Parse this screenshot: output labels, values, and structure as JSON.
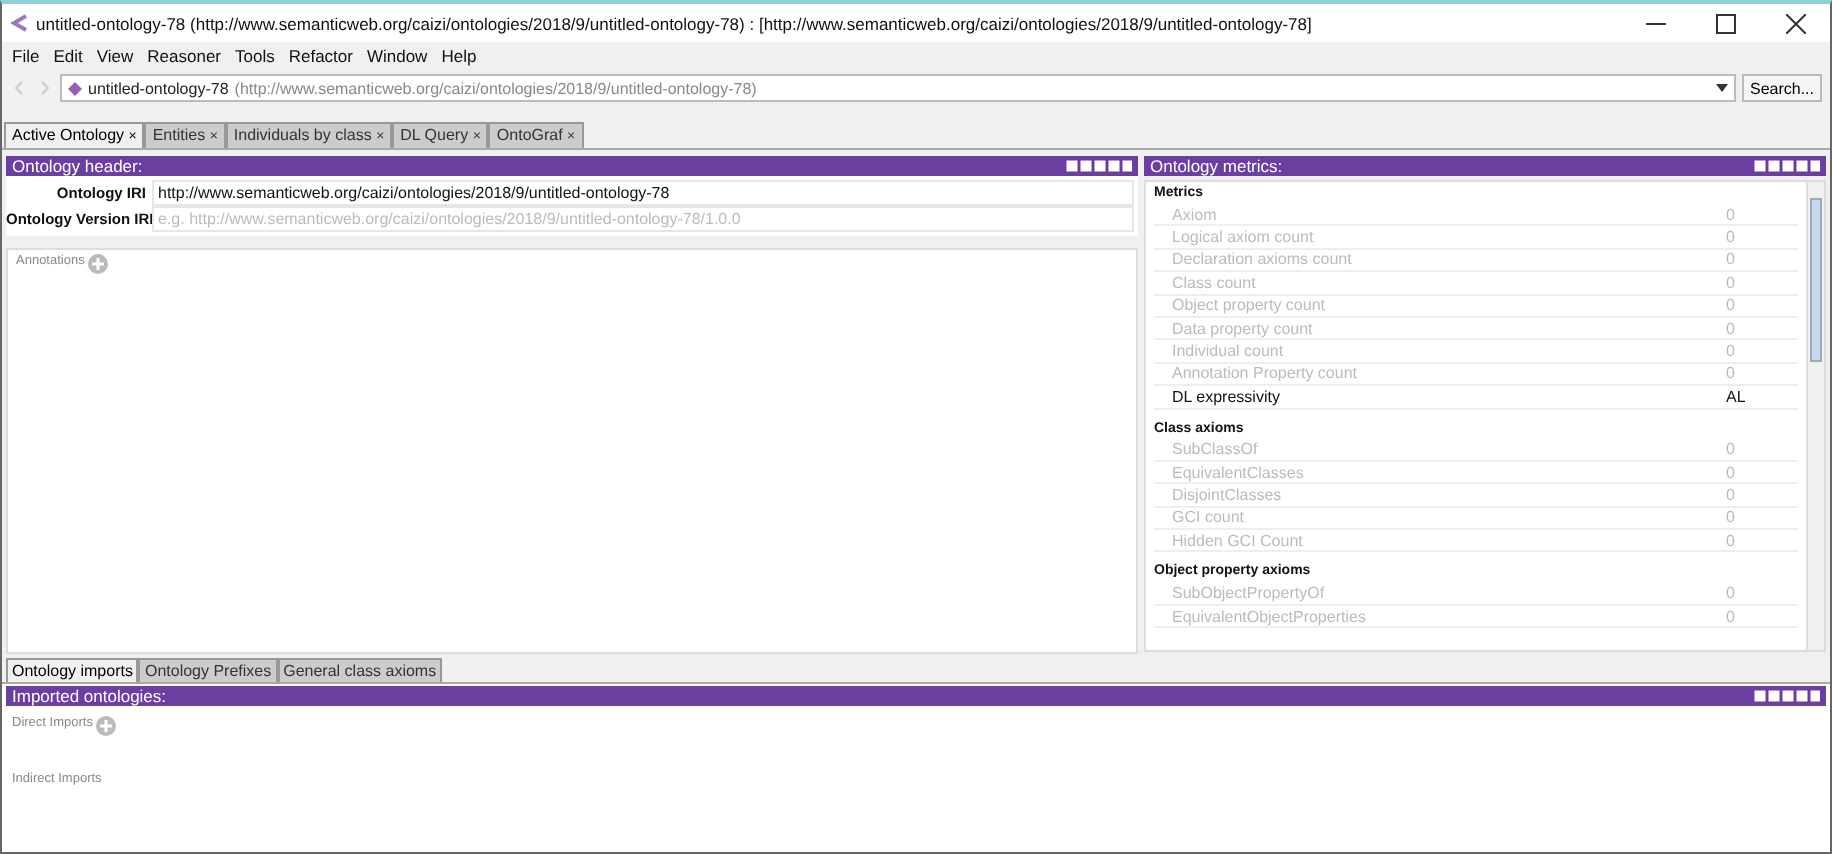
{
  "window": {
    "title": "untitled-ontology-78 (http://www.semanticweb.org/caizi/ontologies/2018/9/untitled-ontology-78)  : [http://www.semanticweb.org/caizi/ontologies/2018/9/untitled-ontology-78]"
  },
  "menu": [
    "File",
    "Edit",
    "View",
    "Reasoner",
    "Tools",
    "Refactor",
    "Window",
    "Help"
  ],
  "nav": {
    "ontology_name": "untitled-ontology-78",
    "ontology_iri": "(http://www.semanticweb.org/caizi/ontologies/2018/9/untitled-ontology-78)",
    "search_button": "Search..."
  },
  "tabs": [
    {
      "label": "Active Ontology",
      "selected": true,
      "close": "×"
    },
    {
      "label": "Entities",
      "selected": false,
      "close": "×"
    },
    {
      "label": "Individuals by class",
      "selected": false,
      "close": "×"
    },
    {
      "label": "DL Query",
      "selected": false,
      "close": "×"
    },
    {
      "label": "OntoGraf",
      "selected": false,
      "close": "×"
    }
  ],
  "header_panel": {
    "title": "Ontology header:",
    "fields": [
      {
        "label": "Ontology IRI",
        "value": "http://www.semanticweb.org/caizi/ontologies/2018/9/untitled-ontology-78"
      },
      {
        "label": "Ontology Version IRI",
        "placeholder": "e.g. http://www.semanticweb.org/caizi/ontologies/2018/9/untitled-ontology-78/1.0.0"
      }
    ],
    "annotations_label": "Annotations"
  },
  "metrics_panel": {
    "title": "Ontology metrics:",
    "rows": [
      {
        "kind": "section",
        "label": "Metrics"
      },
      {
        "kind": "metric",
        "label": "Axiom",
        "value": "0",
        "disabled": true
      },
      {
        "kind": "metric",
        "label": "Logical axiom count",
        "value": "0",
        "disabled": true
      },
      {
        "kind": "metric",
        "label": "Declaration axioms count",
        "value": "0",
        "disabled": true
      },
      {
        "kind": "metric",
        "label": "Class count",
        "value": "0",
        "disabled": true
      },
      {
        "kind": "metric",
        "label": "Object property count",
        "value": "0",
        "disabled": true
      },
      {
        "kind": "metric",
        "label": "Data property count",
        "value": "0",
        "disabled": true
      },
      {
        "kind": "metric",
        "label": "Individual count",
        "value": "0",
        "disabled": true
      },
      {
        "kind": "metric",
        "label": "Annotation Property count",
        "value": "0",
        "disabled": true
      },
      {
        "kind": "metric",
        "label": "DL expressivity",
        "value": "AL",
        "disabled": false
      },
      {
        "kind": "section",
        "label": "Class axioms"
      },
      {
        "kind": "metric",
        "label": "SubClassOf",
        "value": "0",
        "disabled": true
      },
      {
        "kind": "metric",
        "label": "EquivalentClasses",
        "value": "0",
        "disabled": true
      },
      {
        "kind": "metric",
        "label": "DisjointClasses",
        "value": "0",
        "disabled": true
      },
      {
        "kind": "metric",
        "label": "GCI count",
        "value": "0",
        "disabled": true
      },
      {
        "kind": "metric",
        "label": "Hidden GCI Count",
        "value": "0",
        "disabled": true
      },
      {
        "kind": "section",
        "label": "Object property axioms"
      },
      {
        "kind": "metric",
        "label": "SubObjectPropertyOf",
        "value": "0",
        "disabled": true
      },
      {
        "kind": "metric",
        "label": "EquivalentObjectProperties",
        "value": "0",
        "disabled": true
      }
    ]
  },
  "bottom_tabs": [
    {
      "label": "Ontology imports",
      "selected": true
    },
    {
      "label": "Ontology Prefixes",
      "selected": false
    },
    {
      "label": "General class axioms",
      "selected": false
    }
  ],
  "imports_panel": {
    "title": "Imported ontologies:",
    "direct_label": "Direct Imports",
    "indirect_label": "Indirect Imports"
  }
}
